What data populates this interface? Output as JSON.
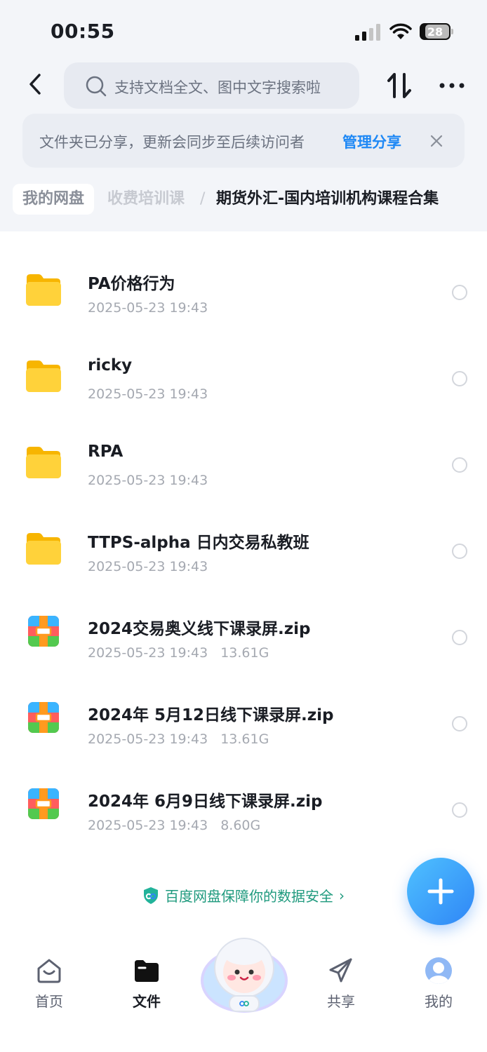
{
  "status_bar": {
    "time": "00:55",
    "battery": "28"
  },
  "header": {
    "search_placeholder": "支持文档全文、图中文字搜索啦"
  },
  "notice": {
    "message": "文件夹已分享，更新会同步至后续访问者",
    "link": "管理分享"
  },
  "breadcrumb": {
    "root": "我的网盘",
    "middle": "收费培训课",
    "separator": "/",
    "current": "期货外汇-国内培训机构课程合集"
  },
  "files": [
    {
      "name": "PA价格行为",
      "date": "2025-05-23 19:43",
      "size": "",
      "type": "folder"
    },
    {
      "name": "ricky",
      "date": "2025-05-23 19:43",
      "size": "",
      "type": "folder"
    },
    {
      "name": "RPA",
      "date": "2025-05-23 19:43",
      "size": "",
      "type": "folder"
    },
    {
      "name": "TTPS-alpha 日内交易私教班",
      "date": "2025-05-23 19:43",
      "size": "",
      "type": "folder"
    },
    {
      "name": "2024交易奥义线下课录屏.zip",
      "date": "2025-05-23 19:43",
      "size": "13.61G",
      "type": "zip"
    },
    {
      "name": "2024年 5月12日线下课录屏.zip",
      "date": "2025-05-23 19:43",
      "size": "13.61G",
      "type": "zip"
    },
    {
      "name": "2024年 6月9日线下课录屏.zip",
      "date": "2025-05-23 19:43",
      "size": "8.60G",
      "type": "zip"
    }
  ],
  "safety": {
    "text": "百度网盘保障你的数据安全",
    "arrow": "›"
  },
  "tabs": {
    "home": "首页",
    "files": "文件",
    "share": "共享",
    "mine": "我的"
  },
  "colors": {
    "accent": "#1e88f5",
    "safety_green": "#1f9a7e",
    "folder_yellow": "#ffc928"
  }
}
